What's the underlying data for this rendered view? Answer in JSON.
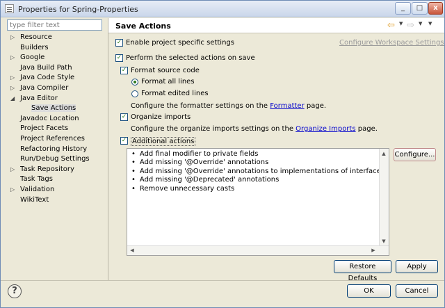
{
  "window": {
    "title": "Properties for Spring-Properties",
    "minimize": "_",
    "maximize": "□",
    "close": "x"
  },
  "filter": {
    "placeholder": "type filter text"
  },
  "tree": [
    {
      "label": "Resource",
      "twisty": "▷"
    },
    {
      "label": "Builders",
      "twisty": ""
    },
    {
      "label": "Google",
      "twisty": "▷"
    },
    {
      "label": "Java Build Path",
      "twisty": ""
    },
    {
      "label": "Java Code Style",
      "twisty": "▷"
    },
    {
      "label": "Java Compiler",
      "twisty": "▷"
    },
    {
      "label": "Java Editor",
      "twisty": "◢"
    },
    {
      "label": "Save Actions",
      "twisty": ""
    },
    {
      "label": "Javadoc Location",
      "twisty": ""
    },
    {
      "label": "Project Facets",
      "twisty": ""
    },
    {
      "label": "Project References",
      "twisty": ""
    },
    {
      "label": "Refactoring History",
      "twisty": ""
    },
    {
      "label": "Run/Debug Settings",
      "twisty": ""
    },
    {
      "label": "Task Repository",
      "twisty": "▷"
    },
    {
      "label": "Task Tags",
      "twisty": ""
    },
    {
      "label": "Validation",
      "twisty": "▷"
    },
    {
      "label": "WikiText",
      "twisty": ""
    }
  ],
  "header": {
    "title": "Save Actions",
    "back_icon": "⇦",
    "forward_icon": "⇨",
    "dropdown": "▼"
  },
  "settings": {
    "enable_project": {
      "label": "Enable project specific settings",
      "checked": true
    },
    "configure_workspace": "Configure Workspace Settings...",
    "perform_actions": {
      "label": "Perform the selected actions on save",
      "checked": true
    },
    "format_source": {
      "label": "Format source code",
      "checked": true
    },
    "format_all": {
      "label": "Format all lines",
      "selected": true
    },
    "format_edited": {
      "label": "Format edited lines",
      "selected": false
    },
    "formatter_pre": "Configure the formatter settings on the",
    "formatter_link": "Formatter",
    "formatter_post": "page.",
    "organize_imports": {
      "label": "Organize imports",
      "checked": true
    },
    "organize_pre": "Configure the organize imports settings on the",
    "organize_link": "Organize Imports",
    "organize_post": "page.",
    "additional_actions": {
      "label": "Additional actions",
      "checked": true
    },
    "actions": [
      "Add final modifier to private fields",
      "Add missing '@Override' annotations",
      "Add missing '@Override' annotations to implementations of interface methods",
      "Add missing '@Deprecated' annotations",
      "Remove unnecessary casts"
    ],
    "bullet": "•",
    "check_mark": "✓"
  },
  "buttons": {
    "configure": "Configure...",
    "restore_defaults": "Restore Defaults",
    "apply": "Apply",
    "ok": "OK",
    "cancel": "Cancel",
    "help": "?"
  },
  "scroll": {
    "up": "▲",
    "down": "▼",
    "left": "◀",
    "right": "▶"
  }
}
